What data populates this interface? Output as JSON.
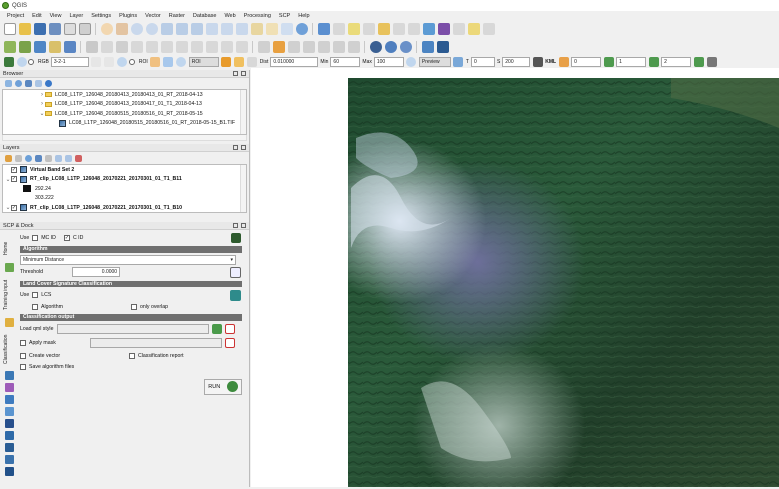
{
  "app": {
    "title": "QGIS"
  },
  "menu": [
    "Project",
    "Edit",
    "View",
    "Layer",
    "Settings",
    "Plugins",
    "Vector",
    "Raster",
    "Database",
    "Web",
    "Processing",
    "SCP",
    "Help"
  ],
  "scp_toolbar": {
    "rgb_label": "RGB",
    "rgb_value": "3-2-1",
    "roi_label": "ROI",
    "roi_label2": "ROI",
    "dist_label": "Dist",
    "dist_value": "0.010000",
    "min_label": "Min",
    "min_value": "60",
    "max_label": "Max",
    "max_value": "100",
    "preview_label": "Preview",
    "t_label": "T",
    "t_value": "0",
    "s_label": "S",
    "s_value": "200",
    "kml_label": "KML",
    "band_a": "0",
    "band_b": "1",
    "band_c": "2"
  },
  "browser": {
    "title": "Browser",
    "items": [
      {
        "label": "LC08_L1TP_126048_20180413_20180413_01_RT_2018-04-13",
        "type": "folder",
        "expanded": false
      },
      {
        "label": "LC08_L1TP_126048_20180413_20180417_01_T1_2018-04-13",
        "type": "folder",
        "expanded": false
      },
      {
        "label": "LC08_L1TP_126048_20180515_20180516_01_RT_2018-05-15",
        "type": "folder",
        "expanded": true
      },
      {
        "label": "LC08_L1TP_126048_20180515_20180516_01_RT_2018-05-15_B1.TIF",
        "type": "raster",
        "expanded": false
      }
    ]
  },
  "layers": {
    "title": "Layers",
    "items": [
      {
        "label": "Virtual Band Set 2",
        "checked": true,
        "bold": true,
        "expanded": false
      },
      {
        "label": "RT_clip_LC08_L1TP_126048_20170221_20170301_01_T1_B11",
        "checked": true,
        "bold": true,
        "expanded": true
      },
      {
        "label": "292.24",
        "legend": "#111111"
      },
      {
        "label": "303.222",
        "legend": "#ffffff"
      },
      {
        "label": "RT_clip_LC08_L1TP_126048_20170221_20170301_01_T1_B10",
        "checked": true,
        "bold": true,
        "expanded": true
      }
    ]
  },
  "scp_dock": {
    "title": "SCP & Dock",
    "side_tabs": [
      "Home",
      "Training input",
      "Classification"
    ],
    "use_label": "Use",
    "mc_id_label": "MC ID",
    "c_id_label": "C ID",
    "algorithm_section": "Algorithm",
    "algorithm_value": "Minimum Distance",
    "threshold_label": "Threshold",
    "threshold_value": "0.0000",
    "lcs_section": "Land Cover Signature Classification",
    "lcs_use_label": "Use",
    "lcs_label": "LCS",
    "algorithm_check_label": "Algorithm",
    "only_overlap_label": "only overlap",
    "output_section": "Classification output",
    "load_qml_label": "Load qml style",
    "apply_mask_label": "Apply mask",
    "create_vector_label": "Create vector",
    "classification_report_label": "Classification report",
    "save_algorithm_label": "Save algorithm files",
    "run_label": "RUN"
  }
}
